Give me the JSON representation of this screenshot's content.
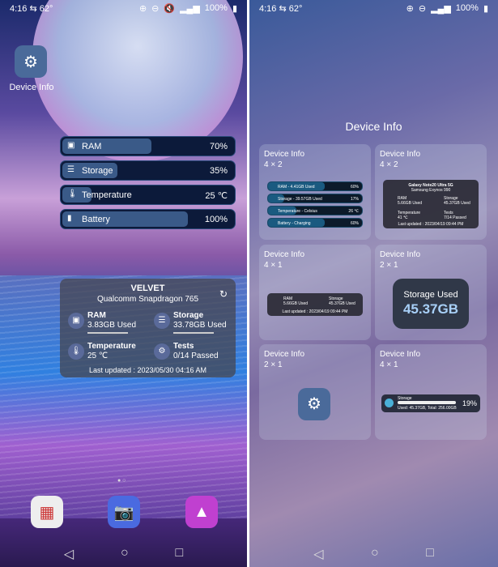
{
  "status": {
    "time": "4:16",
    "temp": "62°",
    "battery": "100%"
  },
  "left": {
    "app": {
      "label": "Device Info"
    },
    "bars": [
      {
        "icon": "chip-icon",
        "label": "RAM",
        "value": "70%",
        "pct": 70
      },
      {
        "icon": "storage-icon",
        "label": "Storage",
        "value": "35%",
        "pct": 35
      },
      {
        "icon": "thermometer-icon",
        "label": "Temperature",
        "value": "25 ℃",
        "pct": 10
      },
      {
        "icon": "battery-icon",
        "label": "Battery",
        "value": "100%",
        "pct": 100
      }
    ],
    "card": {
      "title": "VELVET",
      "subtitle": "Qualcomm Snapdragon 765",
      "cells": [
        {
          "label": "RAM",
          "value": "3.83GB Used"
        },
        {
          "label": "Storage",
          "value": "33.78GB Used"
        },
        {
          "label": "Temperature",
          "value": "25 ℃"
        },
        {
          "label": "Tests",
          "value": "0/14 Passed"
        }
      ],
      "updated": "Last updated : 2023/05/30 04:16 AM"
    }
  },
  "right": {
    "title": "Device Info",
    "tiles": [
      {
        "name": "Device Info",
        "size": "4 × 2"
      },
      {
        "name": "Device Info",
        "size": "4 × 2"
      },
      {
        "name": "Device Info",
        "size": "4 × 1"
      },
      {
        "name": "Device Info",
        "size": "2 × 1"
      },
      {
        "name": "Device Info",
        "size": "2 × 1"
      },
      {
        "name": "Device Info",
        "size": "4 × 1"
      }
    ],
    "preview_bars": [
      {
        "label": "RAM - 4.41GB Used",
        "value": "60%",
        "pct": 60
      },
      {
        "label": "Storage - 39.57GB Used",
        "value": "17%",
        "pct": 17
      },
      {
        "label": "Temperature - Celsius",
        "value": "26 ℃",
        "pct": 30
      },
      {
        "label": "Battery - Charging",
        "value": "60%",
        "pct": 60
      }
    ],
    "preview_card": {
      "title": "Galaxy Note20 Ultra 5G",
      "subtitle": "Samsung Exynos 990",
      "cells": [
        {
          "label": "RAM",
          "value": "5.66GB Used"
        },
        {
          "label": "Storage",
          "value": "45.37GB Used"
        },
        {
          "label": "Temperature",
          "value": "41 ℃"
        },
        {
          "label": "Tests",
          "value": "7/14 Passed"
        }
      ],
      "updated": "Last updated : 2023/04/19 09:44 PM"
    },
    "preview_small": {
      "cells": [
        {
          "label": "RAM",
          "value": "5.66GB Used"
        },
        {
          "label": "Storage",
          "value": "45.37GB Used"
        }
      ],
      "updated": "Last updated : 2023/04/19 09:44 PM"
    },
    "storage_used": {
      "label": "Storage Used",
      "value": "45.37GB"
    },
    "storage_bar": {
      "label": "Storage",
      "value": "19%",
      "pct": 19,
      "detail": "Used: 45.37GB, Total: 256.00GB"
    }
  }
}
